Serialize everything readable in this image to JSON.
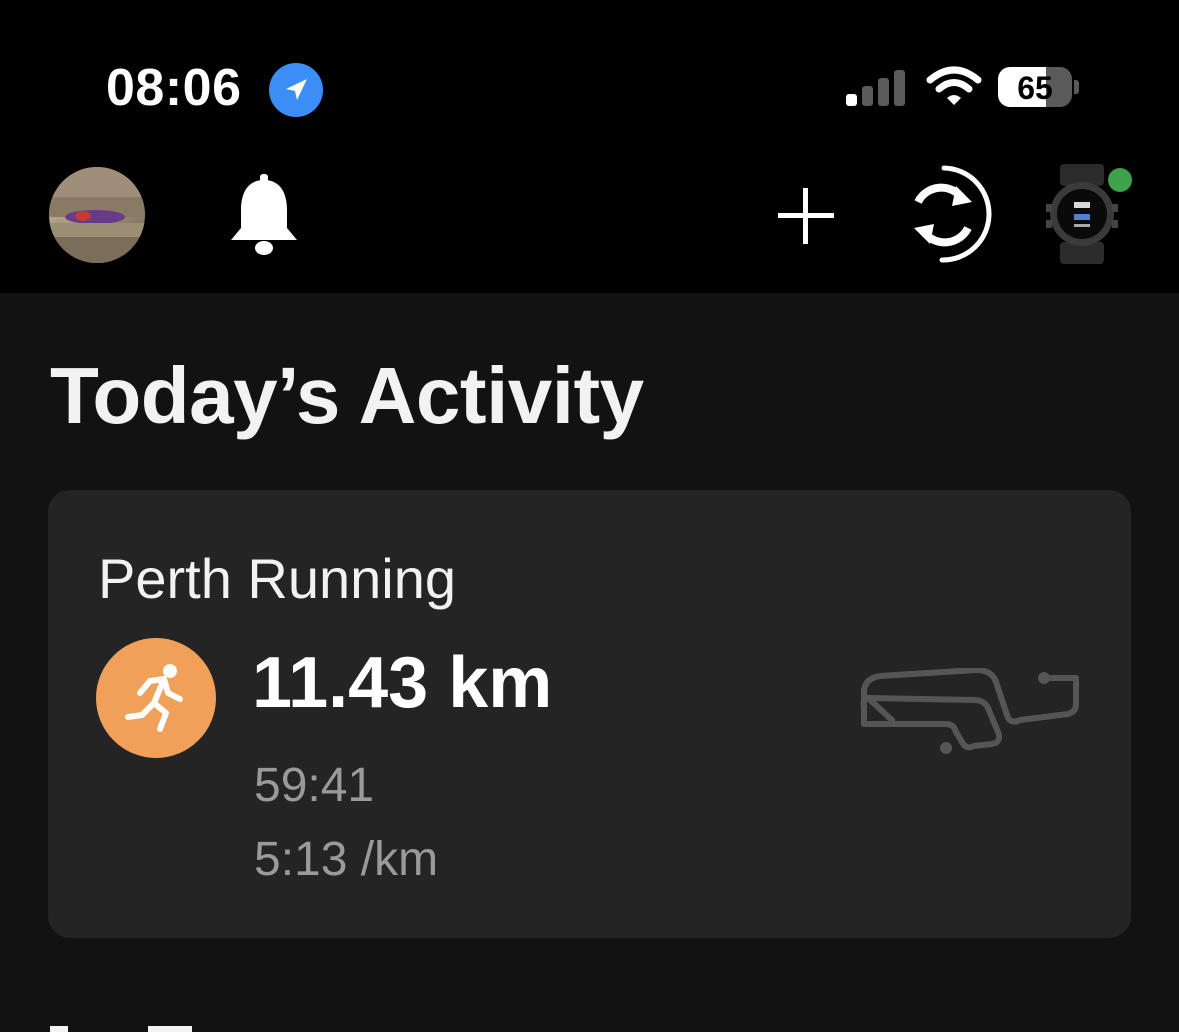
{
  "status_bar": {
    "time": "08:06",
    "location_icon": "location-arrow-icon",
    "signal_icon": "cellular-signal-icon",
    "wifi_icon": "wifi-icon",
    "battery_level": "65",
    "battery_fraction": 0.65
  },
  "header": {
    "avatar": "profile-avatar",
    "notifications_icon": "bell-icon",
    "add_icon": "plus-icon",
    "sync_icon": "sync-icon",
    "device_icon": "watch-icon",
    "device_status_color": "#3ea24c"
  },
  "main": {
    "title": "Today’s Activity",
    "activity": {
      "name": "Perth Running",
      "icon": "running-icon",
      "icon_color": "#f0a059",
      "distance": "11.43 km",
      "duration": "59:41",
      "pace": "5:13 /km",
      "route_icon": "route-map-icon"
    }
  }
}
